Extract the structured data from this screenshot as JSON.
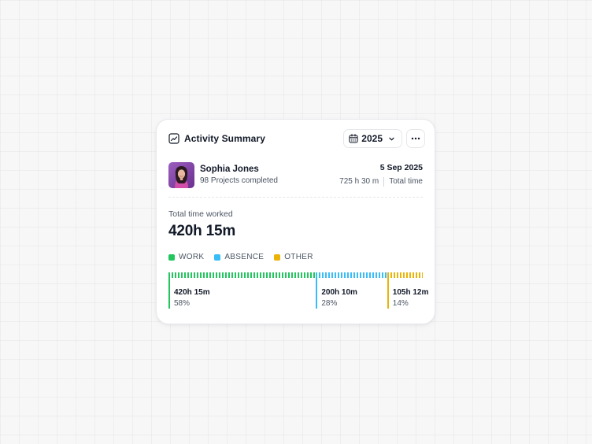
{
  "card": {
    "title": "Activity Summary",
    "title_icon": "trend-chart-icon",
    "year": "2025",
    "calendar_icon": "calendar-icon",
    "dropdown_icon": "chevron-down-icon",
    "more_icon": "more-dots-icon"
  },
  "user": {
    "name": "Sophia Jones",
    "subtitle": "98 Projects completed",
    "date": "5 Sep 2025",
    "time_value": "725 h 30 m",
    "time_label": "Total time"
  },
  "summary": {
    "label": "Total time worked",
    "value": "420h 15m"
  },
  "legend": [
    {
      "label": "WORK",
      "color": "#22c55e"
    },
    {
      "label": "ABSENCE",
      "color": "#38bdf8"
    },
    {
      "label": "OTHER",
      "color": "#eab308"
    }
  ],
  "segments": [
    {
      "value": "420h 15m",
      "percent": "58%",
      "share": 58,
      "color": "#22c55e"
    },
    {
      "value": "200h 10m",
      "percent": "28%",
      "share": 28,
      "color": "#38bdf8"
    },
    {
      "value": "105h 12m",
      "percent": "14%",
      "share": 14,
      "color": "#eab308"
    }
  ]
}
